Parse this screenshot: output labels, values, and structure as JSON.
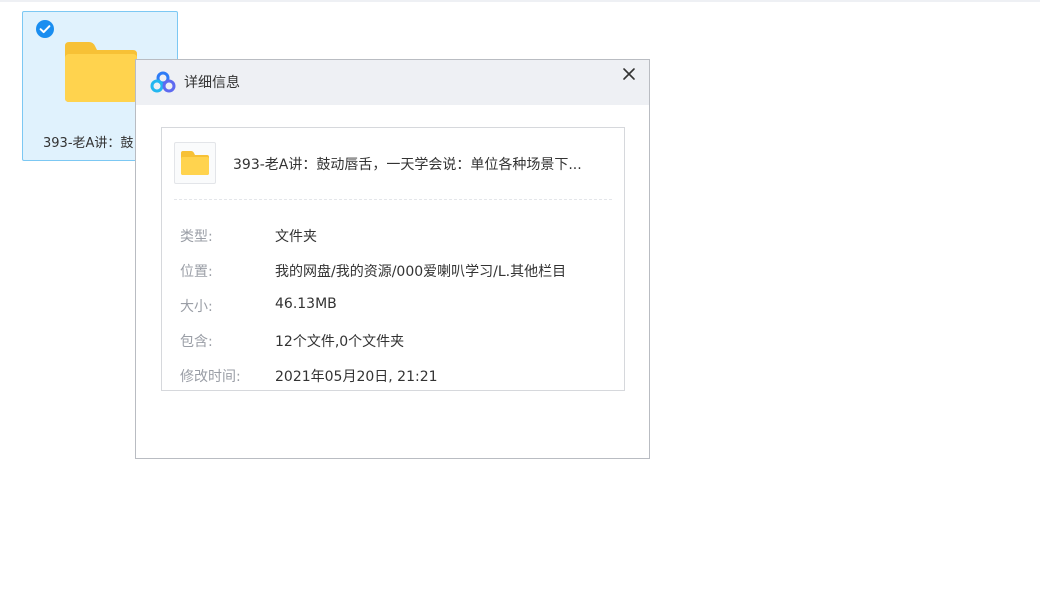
{
  "tile": {
    "name": "393-老A讲：鼓"
  },
  "dialog": {
    "title": "详细信息",
    "file_name": "393-老A讲：鼓动唇舌，一天学会说：单位各种场景下...",
    "rows": [
      {
        "label": "类型:",
        "value": "文件夹"
      },
      {
        "label": "位置:",
        "value": "我的网盘/我的资源/000爱喇叭学习/L.其他栏目"
      },
      {
        "label": "大小:",
        "value": "46.13MB"
      },
      {
        "label": "包含:",
        "value": "12个文件,0个文件夹"
      },
      {
        "label": "修改时间:",
        "value": "2021年05月20日, 21:21"
      }
    ]
  },
  "icons": {
    "check": "check-circle-icon",
    "folder": "folder-icon",
    "logo": "baidu-netdisk-logo-icon",
    "close": "close-icon"
  },
  "colors": {
    "folder": "#ffd34e",
    "folder_tab": "#f7c136",
    "selection_bg": "#e0f2fd",
    "selection_border": "#7cc8f3",
    "check": "#1a8ef0"
  }
}
